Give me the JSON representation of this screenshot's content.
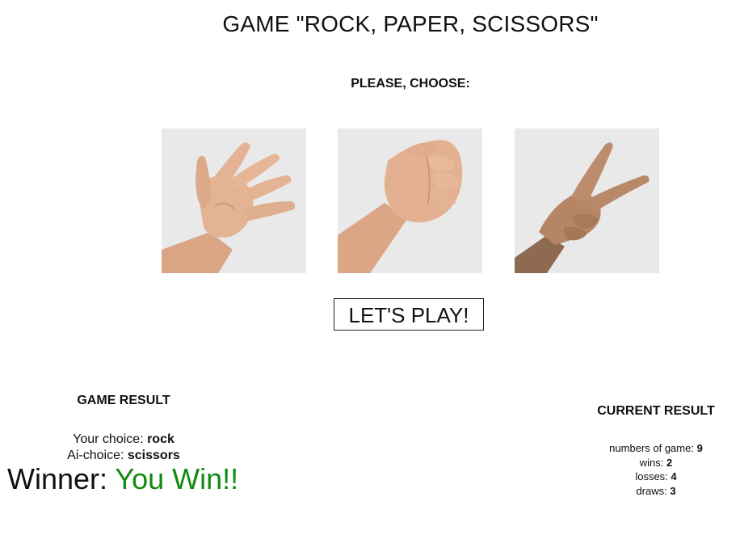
{
  "header": {
    "title": "GAME \"ROCK, PAPER, SCISSORS\"",
    "prompt": "PLEASE, CHOOSE:"
  },
  "choices": [
    {
      "id": "paper",
      "icon": "open-palm-hand"
    },
    {
      "id": "rock",
      "icon": "closed-fist-hand"
    },
    {
      "id": "scissors",
      "icon": "v-sign-hand"
    }
  ],
  "play_button": {
    "label": "LET'S PLAY!"
  },
  "game_result": {
    "heading": "GAME RESULT",
    "your_choice_label": "Your choice:",
    "your_choice_value": "rock",
    "ai_choice_label": "Ai-choice:",
    "ai_choice_value": "scissors",
    "winner_label": "Winner:",
    "winner_value": "You Win!!",
    "winner_color": "#128a12"
  },
  "current_result": {
    "heading": "CURRENT RESULT",
    "games_label": "numbers of game:",
    "games_value": "9",
    "wins_label": "wins:",
    "wins_value": "2",
    "losses_label": "losses:",
    "losses_value": "4",
    "draws_label": "draws:",
    "draws_value": "3"
  }
}
